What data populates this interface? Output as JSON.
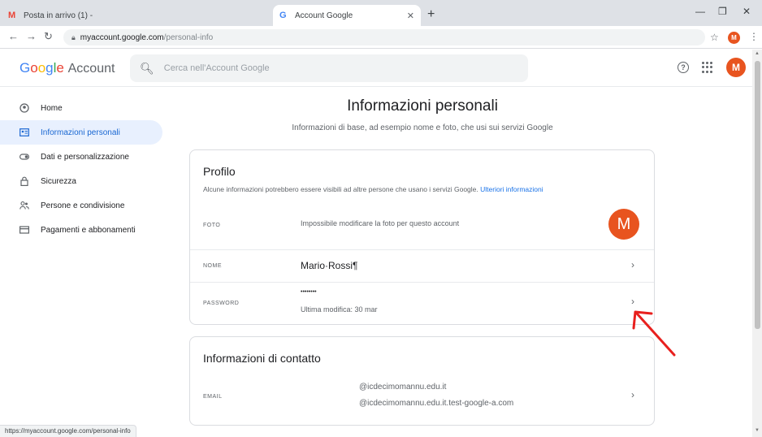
{
  "browser": {
    "tabs": [
      {
        "label": "Posta in arrivo (1) -",
        "favicon": "M"
      },
      {
        "label": "Account Google",
        "favicon": "G"
      }
    ],
    "new_tab_icon": "+",
    "url_host": "myaccount.google.com",
    "url_path": "/personal-info",
    "avatar_letter": "M",
    "status_url": "https://myaccount.google.com/personal-info"
  },
  "header": {
    "logo_letters": [
      "G",
      "o",
      "o",
      "g",
      "l",
      "e"
    ],
    "logo_suffix": "Account",
    "search_placeholder": "Cerca nell'Account Google",
    "avatar_letter": "M"
  },
  "sidebar": {
    "items": [
      {
        "label": "Home",
        "icon": "home-icon"
      },
      {
        "label": "Informazioni personali",
        "icon": "id-card-icon",
        "active": true
      },
      {
        "label": "Dati e personalizzazione",
        "icon": "toggle-icon"
      },
      {
        "label": "Sicurezza",
        "icon": "lock-icon"
      },
      {
        "label": "Persone e condivisione",
        "icon": "people-icon"
      },
      {
        "label": "Pagamenti e abbonamenti",
        "icon": "credit-card-icon"
      }
    ]
  },
  "main": {
    "title": "Informazioni personali",
    "subtitle": "Informazioni di base, ad esempio nome e foto, che usi sui servizi Google",
    "profile": {
      "title": "Profilo",
      "description": "Alcune informazioni potrebbero essere visibili ad altre persone che usano i servizi Google.",
      "link": "Ulteriori informazioni",
      "photo_label": "FOTO",
      "photo_value": "Impossibile modificare la foto per questo account",
      "photo_letter": "M",
      "name_label": "NOME",
      "name_value": "Mario·Rossi¶",
      "password_label": "PASSWORD",
      "password_value": "••••••••",
      "password_modified": "Ultima modifica: 30 mar"
    },
    "contact": {
      "title": "Informazioni di contatto",
      "email_label": "EMAIL",
      "email_1": "@icdecimomannu.edu.it",
      "email_2": "@icdecimomannu.edu.it.test-google-a.com"
    }
  },
  "colors": {
    "accent": "#1a73e8",
    "avatar": "#e8541f",
    "active_nav_bg": "#e8f0fe",
    "annotation_arrow": "#e8201e"
  }
}
